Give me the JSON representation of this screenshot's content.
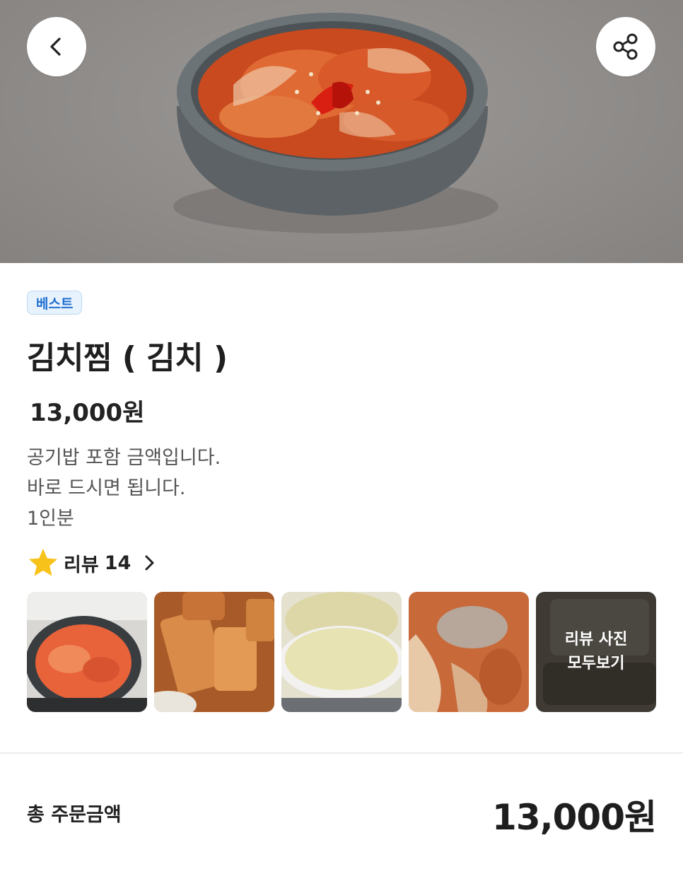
{
  "product": {
    "badge": "베스트",
    "title": "김치찜 ( 김치 )",
    "price": "13,000원",
    "description": [
      "공기밥 포함 금액입니다.",
      "바로 드시면 됩니다.",
      "1인분"
    ]
  },
  "reviews": {
    "label": "리뷰",
    "count": "14",
    "more_line1": "리뷰 사진",
    "more_line2": "모두보기"
  },
  "order": {
    "total_label": "총 주문금액",
    "total_price": "13,000원"
  },
  "icons": {
    "back": "chevron-left-icon",
    "share": "share-icon",
    "rating": "star-icon",
    "review_more": "chevron-right-icon"
  },
  "colors": {
    "badge_text": "#1f6fd1",
    "badge_bg": "#e8f2fc",
    "star": "#f7c21a"
  }
}
